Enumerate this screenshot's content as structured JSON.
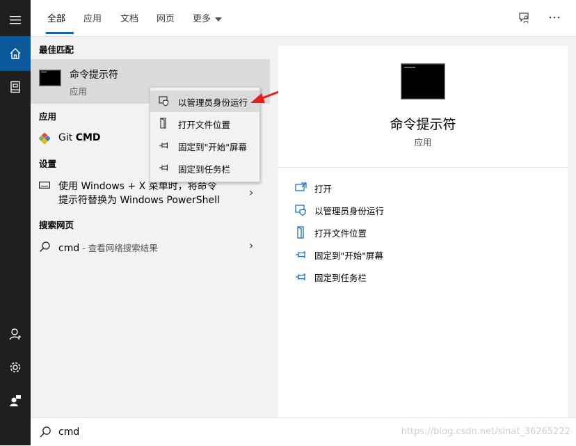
{
  "tabs": [
    "全部",
    "应用",
    "文档",
    "网页",
    "更多"
  ],
  "results": {
    "best_match_title": "最佳匹配",
    "best_match": {
      "name": "命令提示符",
      "type": "应用"
    },
    "apps_title": "应用",
    "app": {
      "prefix": "Git ",
      "bold": "CMD"
    },
    "settings_title": "设置",
    "setting": {
      "line1": "使用 Windows + X 菜单时，将命令",
      "line2": "提示符替换为 Windows PowerShell"
    },
    "web_title": "搜索网页",
    "web": {
      "query": "cmd",
      "hint": " - 查看网络搜索结果"
    }
  },
  "context_menu": [
    "以管理员身份运行",
    "打开文件位置",
    "固定到\"开始\"屏幕",
    "固定到任务栏"
  ],
  "preview": {
    "name": "命令提示符",
    "type": "应用",
    "actions": [
      "打开",
      "以管理员身份运行",
      "打开文件位置",
      "固定到\"开始\"屏幕",
      "固定到任务栏"
    ]
  },
  "search": {
    "value": "cmd"
  },
  "watermark": "https://blog.csdn.net/sinat_36265222",
  "colors": {
    "accent": "#0a64c2",
    "rail": "#1f1f1f",
    "rail_active": "#0a5a9c",
    "arrow": "#e0201c"
  }
}
